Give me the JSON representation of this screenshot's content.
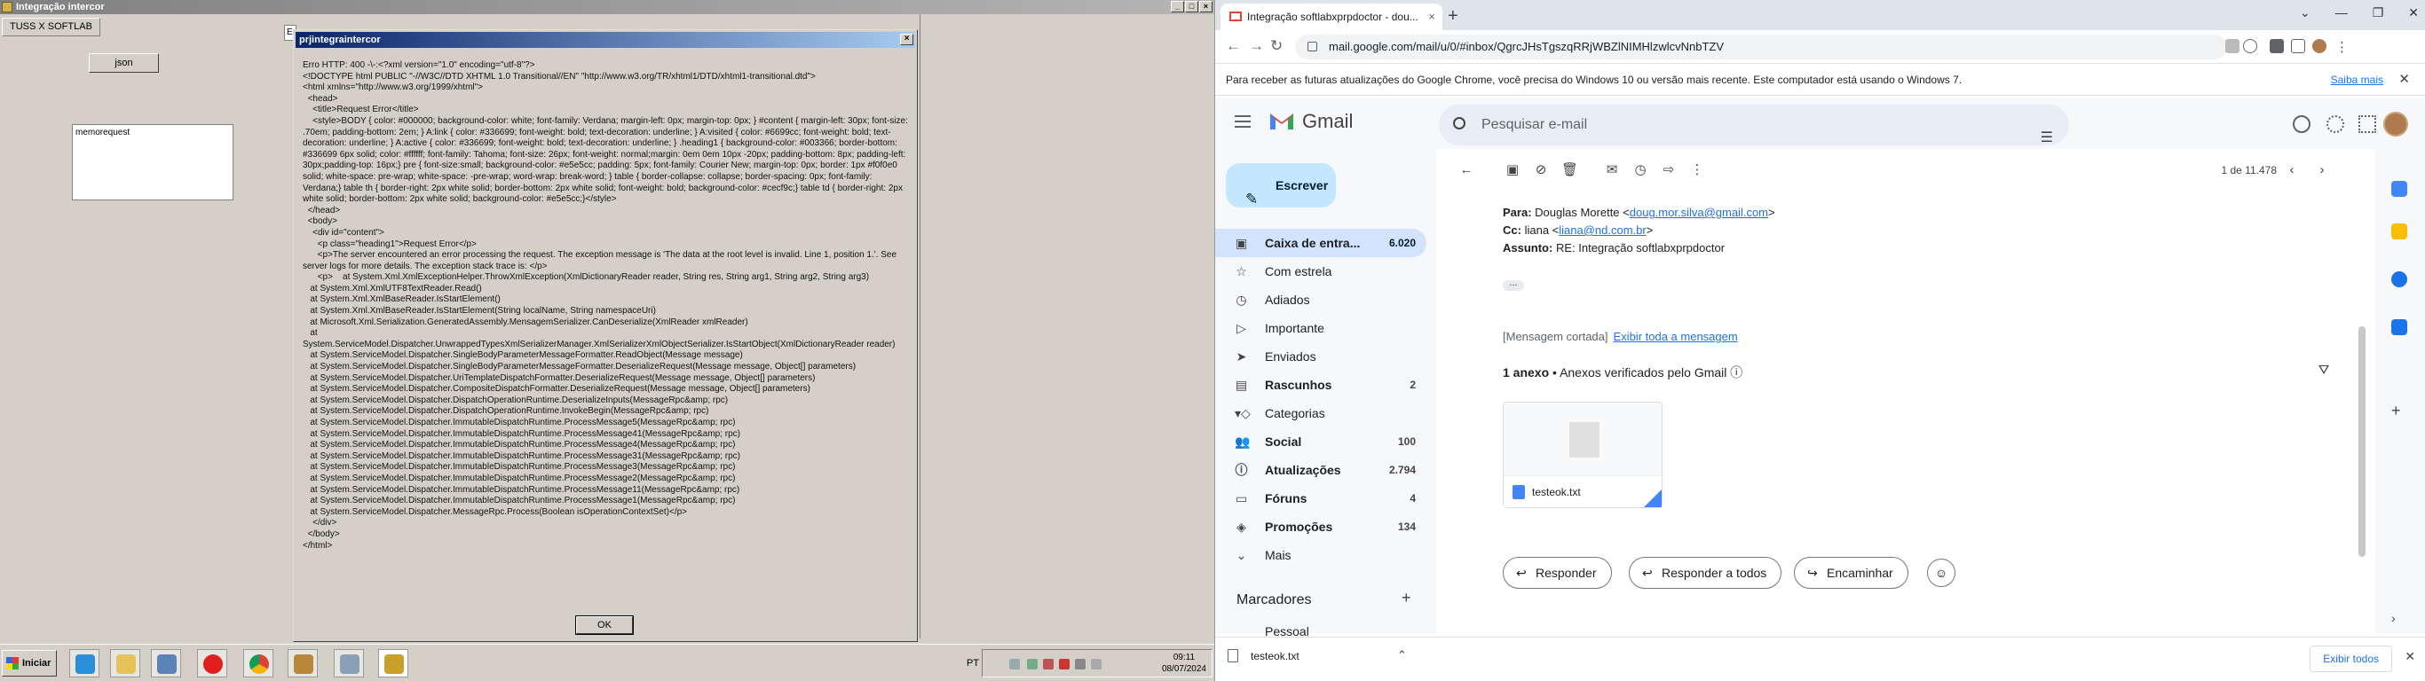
{
  "desktop": {
    "app_title": "Integração intercor",
    "mdi_tab": "TUSS X SOFTLAB",
    "tab_stub": "E",
    "json_button": "json",
    "memo_text": "memorequest",
    "dialog": {
      "title": "prjintegraintercor",
      "body": "Erro HTTP: 400 -\\-:<?xml version=\"1.0\" encoding=\"utf-8\"?>\n<!DOCTYPE html PUBLIC \"-//W3C//DTD XHTML 1.0 Transitional//EN\" \"http://www.w3.org/TR/xhtml1/DTD/xhtml1-transitional.dtd\">\n<html xmlns=\"http://www.w3.org/1999/xhtml\">\n  <head>\n    <title>Request Error</title>\n    <style>BODY { color: #000000; background-color: white; font-family: Verdana; margin-left: 0px; margin-top: 0px; } #content { margin-left: 30px; font-size: .70em; padding-bottom: 2em; } A:link { color: #336699; font-weight: bold; text-decoration: underline; } A:visited { color: #6699cc; font-weight: bold; text-decoration: underline; } A:active { color: #336699; font-weight: bold; text-decoration: underline; } .heading1 { background-color: #003366; border-bottom: #336699 6px solid; color: #ffffff; font-family: Tahoma; font-size: 26px; font-weight: normal;margin: 0em 0em 10px -20px; padding-bottom: 8px; padding-left: 30px;padding-top: 16px;} pre { font-size:small; background-color: #e5e5cc; padding: 5px; font-family: Courier New; margin-top: 0px; border: 1px #f0f0e0 solid; white-space: pre-wrap; white-space: -pre-wrap; word-wrap: break-word; } table { border-collapse: collapse; border-spacing: 0px; font-family: Verdana;} table th { border-right: 2px white solid; border-bottom: 2px white solid; font-weight: bold; background-color: #cecf9c;} table td { border-right: 2px white solid; border-bottom: 2px white solid; background-color: #e5e5cc;}</style>\n  </head>\n  <body>\n    <div id=\"content\">\n      <p class=\"heading1\">Request Error</p>\n      <p>The server encountered an error processing the request. The exception message is 'The data at the root level is invalid. Line 1, position 1.'. See server logs for more details. The exception stack trace is: </p>\n      <p>    at System.Xml.XmlExceptionHelper.ThrowXmlException(XmlDictionaryReader reader, String res, String arg1, String arg2, String arg3)\n   at System.Xml.XmlUTF8TextReader.Read()\n   at System.Xml.XmlBaseReader.IsStartElement()\n   at System.Xml.XmlBaseReader.IsStartElement(String localName, String namespaceUri)\n   at Microsoft.Xml.Serialization.GeneratedAssembly.MensagemSerializer.CanDeserialize(XmlReader xmlReader)\n   at\nSystem.ServiceModel.Dispatcher.UnwrappedTypesXmlSerializerManager.XmlSerializerXmlObjectSerializer.IsStartObject(XmlDictionaryReader reader)\n   at System.ServiceModel.Dispatcher.SingleBodyParameterMessageFormatter.ReadObject(Message message)\n   at System.ServiceModel.Dispatcher.SingleBodyParameterMessageFormatter.DeserializeRequest(Message message, Object[] parameters)\n   at System.ServiceModel.Dispatcher.UriTemplateDispatchFormatter.DeserializeRequest(Message message, Object[] parameters)\n   at System.ServiceModel.Dispatcher.CompositeDispatchFormatter.DeserializeRequest(Message message, Object[] parameters)\n   at System.ServiceModel.Dispatcher.DispatchOperationRuntime.DeserializeInputs(MessageRpc&amp; rpc)\n   at System.ServiceModel.Dispatcher.DispatchOperationRuntime.InvokeBegin(MessageRpc&amp; rpc)\n   at System.ServiceModel.Dispatcher.ImmutableDispatchRuntime.ProcessMessage5(MessageRpc&amp; rpc)\n   at System.ServiceModel.Dispatcher.ImmutableDispatchRuntime.ProcessMessage41(MessageRpc&amp; rpc)\n   at System.ServiceModel.Dispatcher.ImmutableDispatchRuntime.ProcessMessage4(MessageRpc&amp; rpc)\n   at System.ServiceModel.Dispatcher.ImmutableDispatchRuntime.ProcessMessage31(MessageRpc&amp; rpc)\n   at System.ServiceModel.Dispatcher.ImmutableDispatchRuntime.ProcessMessage3(MessageRpc&amp; rpc)\n   at System.ServiceModel.Dispatcher.ImmutableDispatchRuntime.ProcessMessage2(MessageRpc&amp; rpc)\n   at System.ServiceModel.Dispatcher.ImmutableDispatchRuntime.ProcessMessage11(MessageRpc&amp; rpc)\n   at System.ServiceModel.Dispatcher.ImmutableDispatchRuntime.ProcessMessage1(MessageRpc&amp; rpc)\n   at System.ServiceModel.Dispatcher.MessageRpc.Process(Boolean isOperationContextSet)</p>\n    </div>\n  </body>\n</html>",
      "ok_button": "OK"
    },
    "taskbar": {
      "start_label": "Iniciar",
      "lang": "PT",
      "time": "09:11",
      "date": "08/07/2024"
    }
  },
  "browser": {
    "tab_title": "Integração softlabxprpdoctor - dou...",
    "url": "mail.google.com/mail/u/0/#inbox/QgrcJHsTgszqRRjWBZlNIMHlzwlcvNnbTZV",
    "info_text": "Para receber as futuras atualizações do Google Chrome, você precisa do Windows 10 ou versão mais recente. Este computador está usando o Windows 7.",
    "info_link": "Saiba mais"
  },
  "gmail": {
    "logo_text": "Gmail",
    "search_placeholder": "Pesquisar e-mail",
    "compose": "Escrever",
    "nav": [
      {
        "label": "Caixa de entra...",
        "count": "6.020"
      },
      {
        "label": "Com estrela",
        "count": ""
      },
      {
        "label": "Adiados",
        "count": ""
      },
      {
        "label": "Importante",
        "count": ""
      },
      {
        "label": "Enviados",
        "count": ""
      },
      {
        "label": "Rascunhos",
        "count": "2"
      },
      {
        "label": "Categorias",
        "count": ""
      },
      {
        "label": "Social",
        "count": "100"
      },
      {
        "label": "Atualizações",
        "count": "2.794"
      },
      {
        "label": "Fóruns",
        "count": "4"
      },
      {
        "label": "Promoções",
        "count": "134"
      },
      {
        "label": "Mais",
        "count": ""
      }
    ],
    "labels_title": "Marcadores",
    "labels_partial": "Pessoal",
    "pager": "1 de 11.478",
    "to_label": "Para:",
    "to_name": "Douglas Morette <",
    "to_email": "doug.mor.silva@gmail.com",
    "to_end": ">",
    "cc_label": "Cc:",
    "cc_name": "liana <",
    "cc_email": "liana@nd.com.br",
    "cc_end": ">",
    "subject_label": "Assunto:",
    "subject": "RE: Integração softlabxprpdoctor",
    "ellipsis": "...",
    "trimmed": "[Mensagem cortada]",
    "show_all": "Exibir toda a mensagem",
    "att_count": "1 anexo",
    "att_sep": "•",
    "att_verified": "Anexos verificados pelo Gmail",
    "att_file": "testeok.txt",
    "reply": "Responder",
    "reply_all": "Responder a todos",
    "forward": "Encaminhar"
  },
  "downloads": {
    "file": "testeok.txt",
    "show_all": "Exibir todos"
  },
  "colors": {
    "xp_title": "#0a246a",
    "gmail_active": "#d3e3fd",
    "compose": "#c2e7ff",
    "link": "#1a73e8"
  }
}
